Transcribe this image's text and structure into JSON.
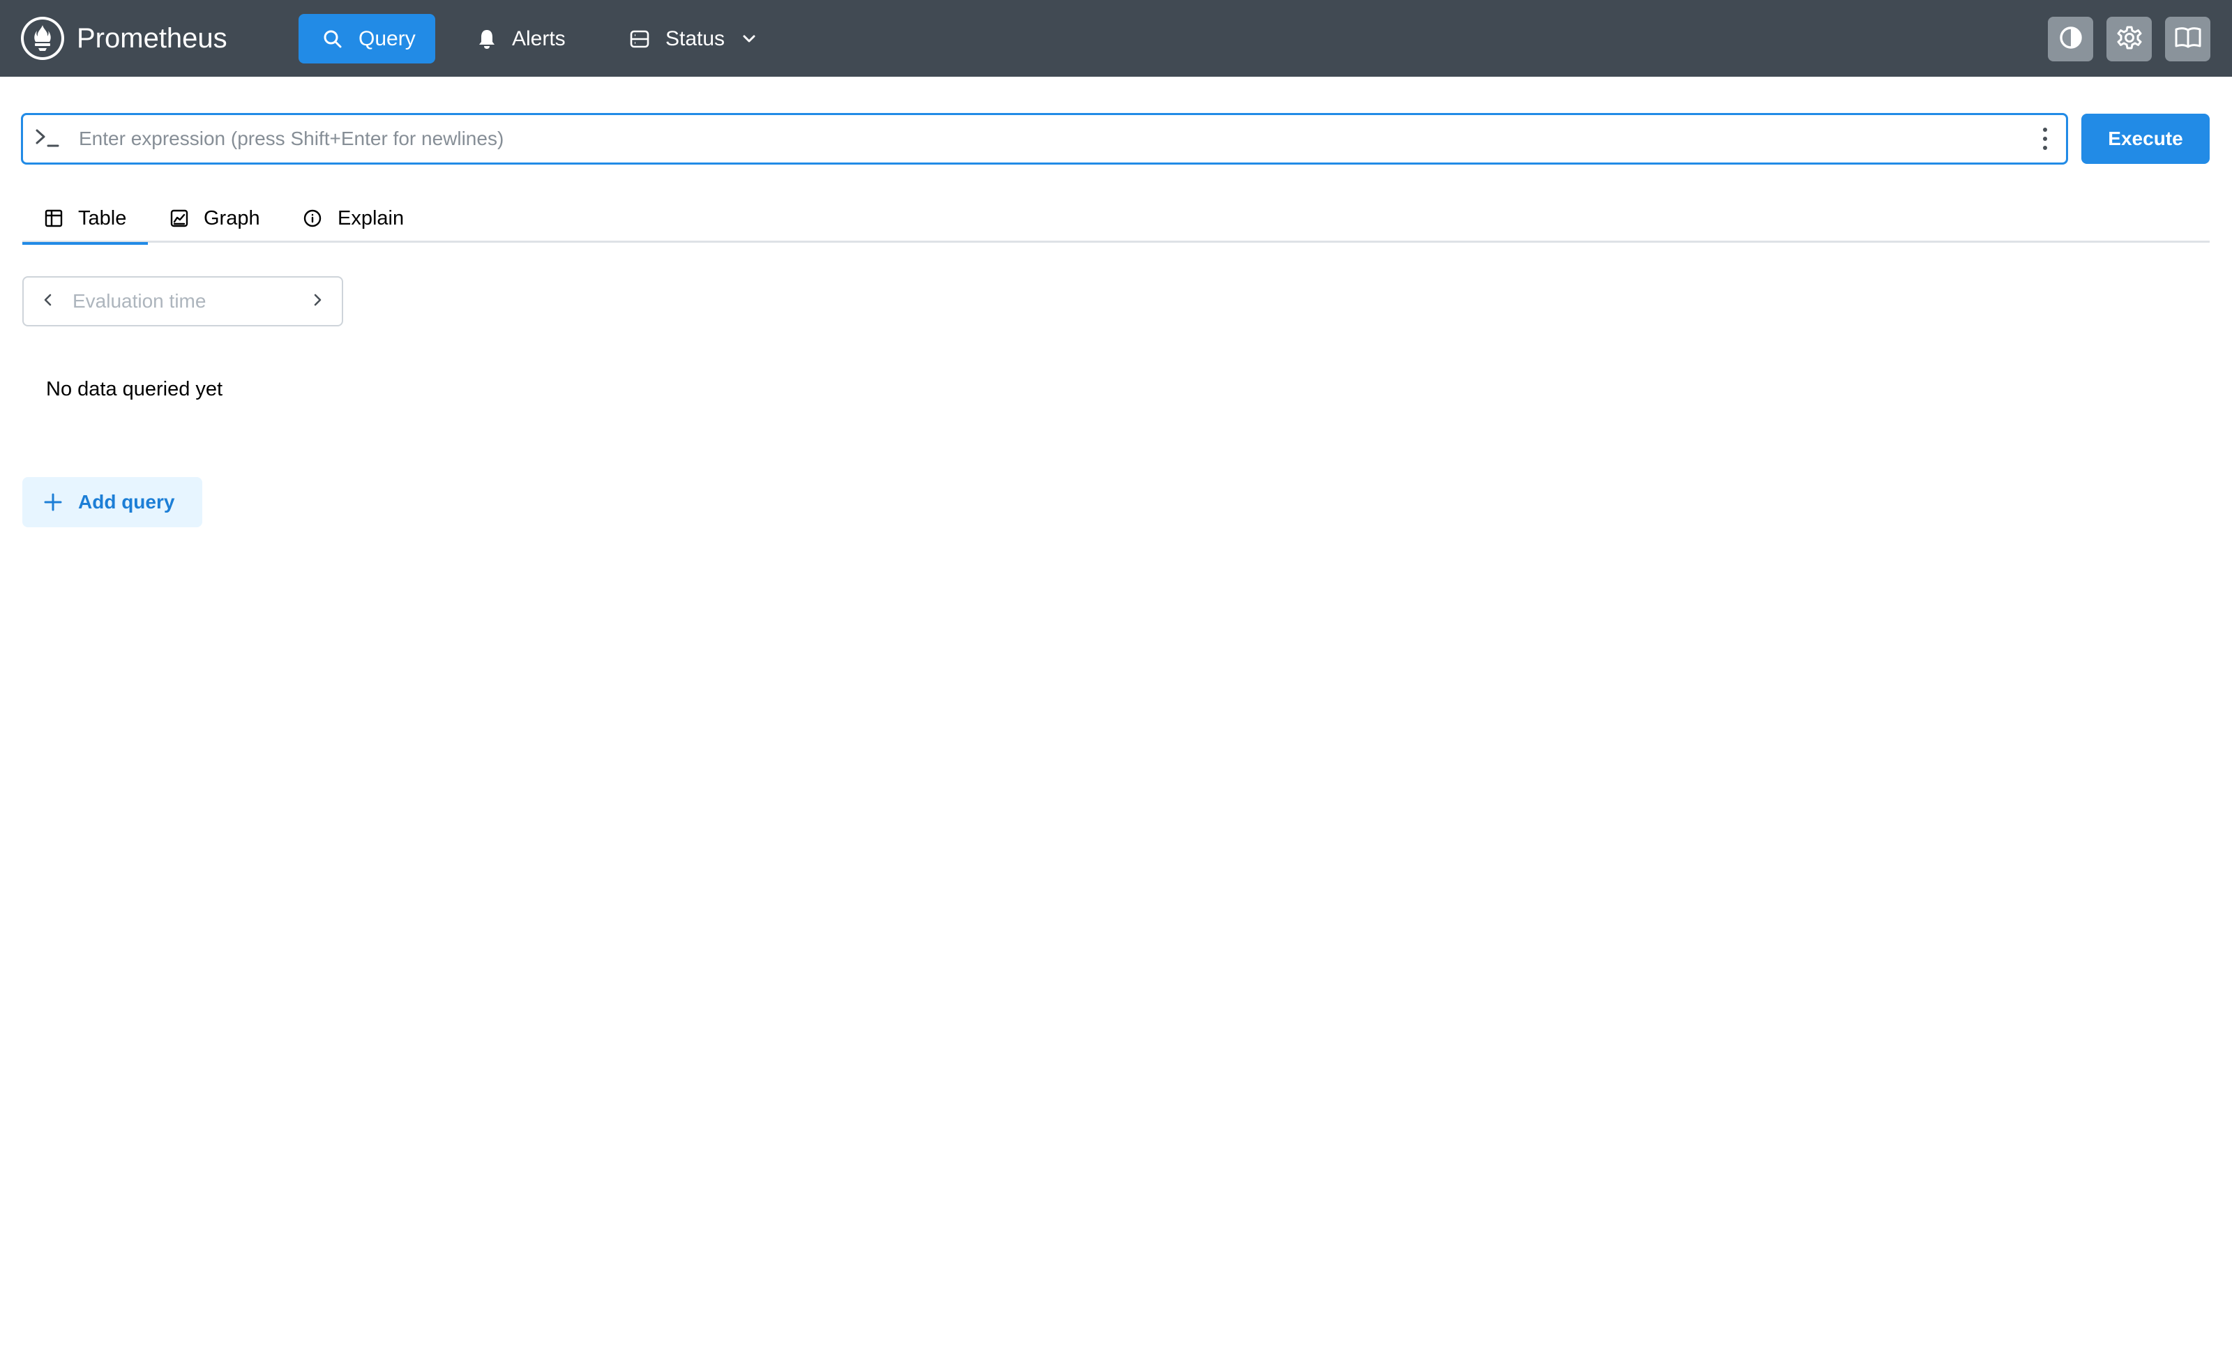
{
  "header": {
    "brand": "Prometheus",
    "nav": {
      "query": "Query",
      "alerts": "Alerts",
      "status": "Status"
    },
    "icons": [
      "theme-toggle-icon",
      "settings-gear-icon",
      "documentation-book-icon"
    ]
  },
  "expression": {
    "placeholder": "Enter expression (press Shift+Enter for newlines)",
    "value": "",
    "execute_label": "Execute"
  },
  "tabs": [
    {
      "label": "Table",
      "icon": "table-icon",
      "active": true
    },
    {
      "label": "Graph",
      "icon": "graph-icon",
      "active": false
    },
    {
      "label": "Explain",
      "icon": "info-icon",
      "active": false
    }
  ],
  "eval_time": {
    "placeholder": "Evaluation time",
    "value": ""
  },
  "results": {
    "empty_message": "No data queried yet"
  },
  "add_query_label": "Add query",
  "colors": {
    "header_bg": "#414a53",
    "accent": "#228be6",
    "add_query_bg": "#e7f5ff"
  }
}
